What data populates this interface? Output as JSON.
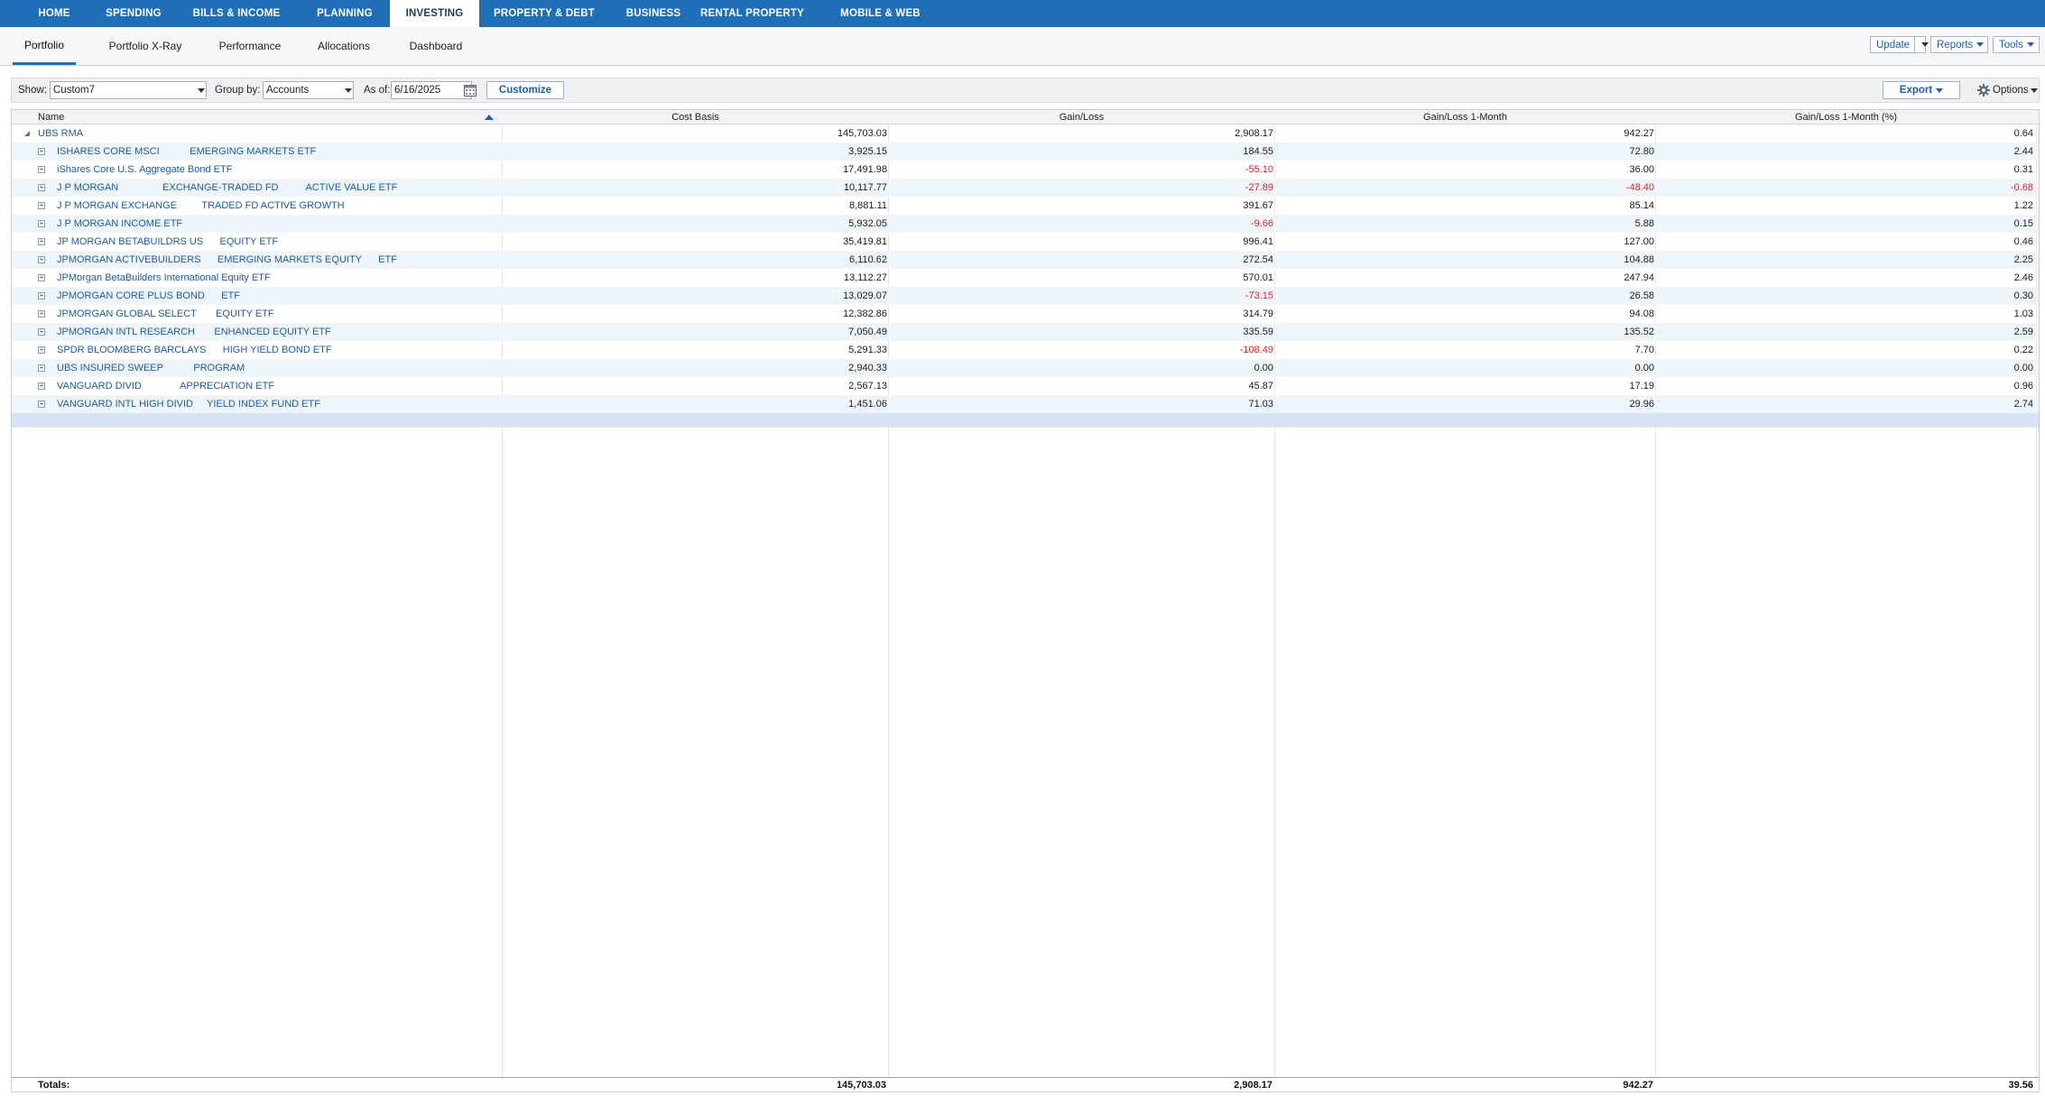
{
  "top_nav": [
    {
      "label": "HOME"
    },
    {
      "label": "SPENDING"
    },
    {
      "label": "BILLS & INCOME"
    },
    {
      "label": "PLANNING"
    },
    {
      "label": "INVESTING",
      "active": true
    },
    {
      "label": "PROPERTY & DEBT"
    },
    {
      "label": "BUSINESS"
    },
    {
      "label": "RENTAL PROPERTY"
    },
    {
      "label": "MOBILE & WEB"
    }
  ],
  "sub_nav": {
    "tabs": [
      {
        "label": "Portfolio",
        "active": true
      },
      {
        "label": "Portfolio X-Ray"
      },
      {
        "label": "Performance"
      },
      {
        "label": "Allocations"
      },
      {
        "label": "Dashboard"
      }
    ],
    "update_label": "Update",
    "reports_label": "Reports",
    "tools_label": "Tools"
  },
  "toolbar": {
    "show_label": "Show:",
    "show_value": "Custom7",
    "group_by_label": "Group by:",
    "group_by_value": "Accounts",
    "as_of_label": "As of:",
    "as_of_value": "6/16/2025",
    "customize_label": "Customize",
    "export_label": "Export",
    "options_label": "Options"
  },
  "table": {
    "columns": [
      "Name",
      "Cost Basis",
      "Gain/Loss",
      "Gain/Loss 1-Month",
      "Gain/Loss 1-Month (%)"
    ],
    "account": {
      "name": "UBS RMA",
      "cost_basis": "145,703.03",
      "gain_loss": "2,908.17",
      "gain_1m": "942.27",
      "gain_1m_pct": "0.64"
    },
    "rows": [
      {
        "name": "ISHARES CORE MSCI           EMERGING MARKETS ETF",
        "cost_basis": "3,925.15",
        "gain_loss": "184.55",
        "gain_1m": "72.80",
        "gain_1m_pct": "2.44"
      },
      {
        "name": "iShares Core U.S. Aggregate Bond ETF",
        "cost_basis": "17,491.98",
        "gain_loss": "-55.10",
        "gain_1m": "36.00",
        "gain_1m_pct": "0.31"
      },
      {
        "name": "J P MORGAN                EXCHANGE-TRADED FD          ACTIVE VALUE ETF",
        "cost_basis": "10,117.77",
        "gain_loss": "-27.89",
        "gain_1m": "-48.40",
        "gain_1m_pct": "-0.68"
      },
      {
        "name": "J P MORGAN EXCHANGE         TRADED FD ACTIVE GROWTH",
        "cost_basis": "8,881.11",
        "gain_loss": "391.67",
        "gain_1m": "85.14",
        "gain_1m_pct": "1.22"
      },
      {
        "name": "J P MORGAN INCOME ETF",
        "cost_basis": "5,932.05",
        "gain_loss": "-9.66",
        "gain_1m": "5.88",
        "gain_1m_pct": "0.15"
      },
      {
        "name": "JP MORGAN BETABUILDRS US      EQUITY ETF",
        "cost_basis": "35,419.81",
        "gain_loss": "996.41",
        "gain_1m": "127.00",
        "gain_1m_pct": "0.46"
      },
      {
        "name": "JPMORGAN ACTIVEBUILDERS      EMERGING MARKETS EQUITY      ETF",
        "cost_basis": "6,110.62",
        "gain_loss": "272.54",
        "gain_1m": "104.88",
        "gain_1m_pct": "2.25"
      },
      {
        "name": "JPMorgan BetaBuilders International Equity ETF",
        "cost_basis": "13,112.27",
        "gain_loss": "570.01",
        "gain_1m": "247.94",
        "gain_1m_pct": "2.46"
      },
      {
        "name": "JPMORGAN CORE PLUS BOND      ETF",
        "cost_basis": "13,029.07",
        "gain_loss": "-73.15",
        "gain_1m": "26.58",
        "gain_1m_pct": "0.30"
      },
      {
        "name": "JPMORGAN GLOBAL SELECT       EQUITY ETF",
        "cost_basis": "12,382.86",
        "gain_loss": "314.79",
        "gain_1m": "94.08",
        "gain_1m_pct": "1.03"
      },
      {
        "name": "JPMORGAN INTL RESEARCH       ENHANCED EQUITY ETF",
        "cost_basis": "7,050.49",
        "gain_loss": "335.59",
        "gain_1m": "135.52",
        "gain_1m_pct": "2.59"
      },
      {
        "name": "SPDR BLOOMBERG BARCLAYS      HIGH YIELD BOND ETF",
        "cost_basis": "5,291.33",
        "gain_loss": "-108.49",
        "gain_1m": "7.70",
        "gain_1m_pct": "0.22"
      },
      {
        "name": "UBS INSURED SWEEP           PROGRAM",
        "cost_basis": "2,940.33",
        "gain_loss": "0.00",
        "gain_1m": "0.00",
        "gain_1m_pct": "0.00"
      },
      {
        "name": "VANGUARD DIVID              APPRECIATION ETF",
        "cost_basis": "2,567.13",
        "gain_loss": "45.87",
        "gain_1m": "17.19",
        "gain_1m_pct": "0.96"
      },
      {
        "name": "VANGUARD INTL HIGH DIVID     YIELD INDEX FUND ETF",
        "cost_basis": "1,451.06",
        "gain_loss": "71.03",
        "gain_1m": "29.96",
        "gain_1m_pct": "2.74"
      }
    ],
    "totals": {
      "label": "Totals:",
      "cost_basis": "145,703.03",
      "gain_loss": "2,908.17",
      "gain_1m": "942.27",
      "gain_1m_pct": "39.56"
    }
  },
  "colors": {
    "nav_blue": "#1f6fb8",
    "link_blue": "#1d5a9e",
    "negative": "#d6232a"
  },
  "icons": [
    "calendar-icon",
    "gear-icon",
    "sort-ascending-icon",
    "expand-icon",
    "collapse-icon"
  ]
}
